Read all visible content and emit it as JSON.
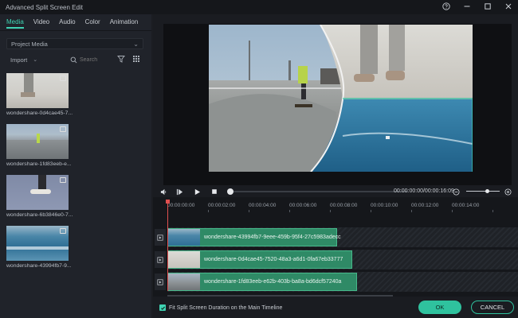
{
  "window": {
    "title": "Advanced Split Screen Edit"
  },
  "tabs": [
    {
      "label": "Media",
      "active": true
    },
    {
      "label": "Video",
      "active": false
    },
    {
      "label": "Audio",
      "active": false
    },
    {
      "label": "Color",
      "active": false
    },
    {
      "label": "Animation",
      "active": false
    }
  ],
  "media_panel": {
    "source_dropdown": "Project Media",
    "import_label": "Import",
    "search_placeholder": "Search",
    "items": [
      {
        "name": "wondershare-0d4cae45-7..."
      },
      {
        "name": "wondershare-1fd83eeb-e..."
      },
      {
        "name": "wondershare-6b3846e0-7..."
      },
      {
        "name": "wondershare-43994fb7-9..."
      }
    ]
  },
  "player": {
    "timecode": "00:00:00:00/00:00:16:09"
  },
  "timeline": {
    "ruler_labels": [
      "00:00:00:00",
      "00:00:02:00",
      "00:00:04:00",
      "00:00:06:00",
      "00:00:08:00",
      "00:00:10:00",
      "00:00:12:00",
      "00:00:14:00"
    ],
    "clips": [
      {
        "label": "wondershare-43994fb7-9eee-459b-95f4-27c5983adecc"
      },
      {
        "label": "wondershare-0d4cae45-7520-48a3-a6d1-0fa67eb33777"
      },
      {
        "label": "wondershare-1fd83eeb-e62b-403b-ba8a-bd6dcf57240a"
      }
    ]
  },
  "footer": {
    "fit_label": "Fit Split Screen Duration on the Main Timeline",
    "fit_checked": true,
    "ok_label": "OK",
    "cancel_label": "CANCEL"
  },
  "colors": {
    "accent": "#3fd3b3",
    "clip": "#2f8a66",
    "playhead": "#e05050"
  }
}
